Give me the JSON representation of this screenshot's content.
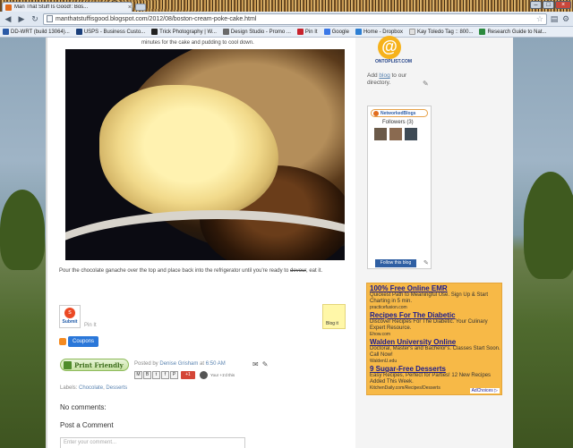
{
  "browser": {
    "tab_title": "Man That Stuff Is Good!: Bos...",
    "tab_close": "×",
    "url": "manthatstuffisgood.blogspot.com/2012/08/boston-cream-poke-cake.html",
    "bookmarks": [
      {
        "label": "DD-WRT (build 13064)...",
        "color": "#2b5aa6"
      },
      {
        "label": "USPS - Business Custo...",
        "color": "#1b3f7a"
      },
      {
        "label": "Trick Photography | W...",
        "color": "#222222"
      },
      {
        "label": "Design Studio - Promo ...",
        "color": "#6a6a6a"
      },
      {
        "label": "Pin It",
        "color": "#c8232c"
      },
      {
        "label": "Google",
        "color": "#3b78e7"
      },
      {
        "label": "Home - Dropbox",
        "color": "#2d7fd3"
      },
      {
        "label": "Kay Toledo Tag :: 800...",
        "color": "#e0e0e0"
      },
      {
        "label": "Research Guide to Nat...",
        "color": "#2b8a3e"
      }
    ]
  },
  "post": {
    "caption_top": "minutes for the cake and pudding to cool down.",
    "after_text_1": "Pour the chocolate ganache over the top and place back into the refrigerator until you're ready to ",
    "after_text_strike": "devour",
    "after_text_2": ", eat it.",
    "stumble_label": "Submit",
    "pinit": "Pin It",
    "blogit": "Blog it",
    "coupons": "Coupons",
    "printfriendly": "Print Friendly",
    "posted_prefix": "Posted by",
    "author": "Denise Grisham",
    "at": "at",
    "time": "6:50 AM",
    "share_buttons": [
      "M",
      "B",
      "t",
      "f",
      "P"
    ],
    "plus_one": "+1",
    "plus_text": "Your +1'd this",
    "labels_prefix": "Labels:",
    "label_1": "Chocolate",
    "label_sep": ",",
    "label_2": "Desserts",
    "no_comments": "No comments:",
    "post_comment": "Post a Comment",
    "comment_placeholder": "Enter your comment..."
  },
  "sidebar": {
    "ontoplist_logo": "@",
    "ontoplist_text": "ONTOPLIST.COM",
    "add_blog_prefix": "Add",
    "add_blog_link": "blog",
    "add_blog_suffix": "to our directory.",
    "networkedblogs": "NetworkedBlogs",
    "followers": "Followers (3)",
    "follow_button": "Follow this blog",
    "ads": [
      {
        "title": "100% Free Online EMR",
        "body": "Quickest Path to Meaningful Use. Sign Up & Start Charting in 5 min.",
        "url": "practicefusion.com"
      },
      {
        "title": "Recipes For The Diabetic",
        "body": "Discover Recipes For The Diabetic. Your Culinary Expert Resource.",
        "url": "Ehow.com"
      },
      {
        "title": "Walden University Online",
        "body": "Doctoral, Master's and Bachelor's. Classes Start Soon. Call Now!",
        "url": "WaldenU.edu"
      },
      {
        "title": "9 Sugar-Free Desserts",
        "body": "Easy Recipes, Perfect for Parties! 12 New Recipes Added This Week.",
        "url": "KitchenDaily.com/Recipes/Desserts"
      }
    ],
    "adchoices": "AdChoices ▷"
  }
}
